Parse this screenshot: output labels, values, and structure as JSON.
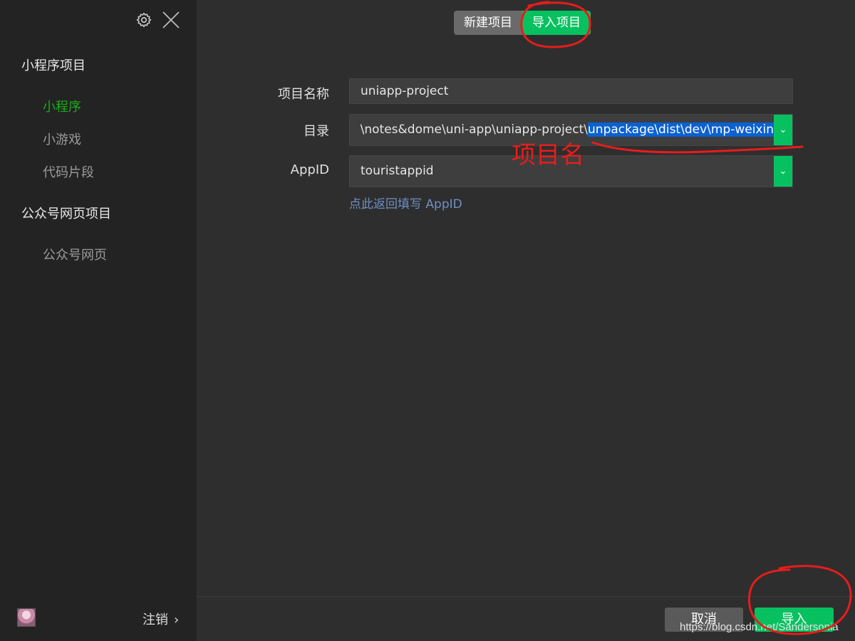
{
  "sidebar": {
    "sections": [
      {
        "title": "小程序项目",
        "items": [
          {
            "label": "小程序",
            "active": true
          },
          {
            "label": "小游戏",
            "active": false
          },
          {
            "label": "代码片段",
            "active": false
          }
        ]
      },
      {
        "title": "公众号网页项目",
        "items": [
          {
            "label": "公众号网页",
            "active": false
          }
        ]
      }
    ],
    "footer": {
      "logout_label": "注销",
      "logout_chevron": "›"
    },
    "icons": {
      "settings": "gear-icon",
      "close": "close-icon"
    }
  },
  "tabs": [
    {
      "label": "新建项目",
      "active": false
    },
    {
      "label": "导入项目",
      "active": true
    }
  ],
  "form": {
    "project_name": {
      "label": "项目名称",
      "value": "uniapp-project"
    },
    "directory": {
      "label": "目录",
      "value_prefix": "ktop\\notes&dome\\uni-app\\uniapp-project\\",
      "value_selected": "unpackage\\dist\\dev\\mp-weixin",
      "dropdown_glyph": "⌄"
    },
    "appid": {
      "label": "AppID",
      "value": "touristappid",
      "dropdown_glyph": "⌄"
    },
    "appid_hint": "点此返回填写 AppID"
  },
  "buttons": {
    "cancel": "取消",
    "import": "导入"
  },
  "annotation": {
    "text": "项目名",
    "color": "#e81c1c"
  },
  "watermark": "https://blog.csdn.net/Sandersonia",
  "colors": {
    "accent_green": "#07c160",
    "active_nav_green": "#1aad19",
    "selection_blue": "#0a61d1",
    "hint_blue": "#6f8fc4"
  }
}
